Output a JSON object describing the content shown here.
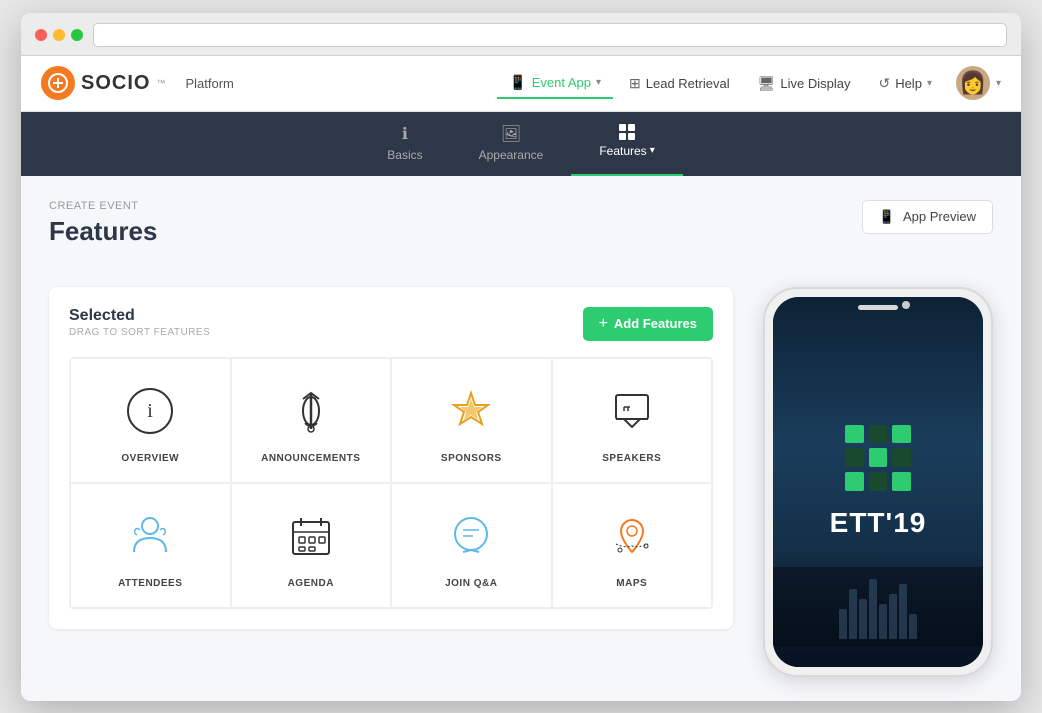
{
  "browser": {
    "url": ""
  },
  "topNav": {
    "logo_text": "SOCIO",
    "logo_tm": "™",
    "platform_label": "Platform",
    "nav_items": [
      {
        "id": "event-app",
        "label": "Event App",
        "icon": "phone",
        "has_chevron": true,
        "active": true
      },
      {
        "id": "lead-retrieval",
        "label": "Lead Retrieval",
        "icon": "scan",
        "has_chevron": false,
        "active": false
      },
      {
        "id": "live-display",
        "label": "Live Display",
        "icon": "monitor",
        "has_chevron": false,
        "active": false
      },
      {
        "id": "help",
        "label": "Help",
        "icon": "refresh",
        "has_chevron": true,
        "active": false
      }
    ]
  },
  "subNav": {
    "items": [
      {
        "id": "basics",
        "label": "Basics",
        "icon": "info",
        "active": false
      },
      {
        "id": "appearance",
        "label": "Appearance",
        "icon": "image",
        "active": false
      },
      {
        "id": "features",
        "label": "Features",
        "icon": "grid",
        "active": true,
        "has_chevron": true
      }
    ]
  },
  "page": {
    "breadcrumb": "CREATE EVENT",
    "title": "Features",
    "app_preview_btn": "App Preview"
  },
  "featuresPanel": {
    "title": "Selected",
    "subtitle": "DRAG TO SORT FEATURES",
    "add_btn": "Add Features",
    "features": [
      {
        "id": "overview",
        "label": "OVERVIEW"
      },
      {
        "id": "announcements",
        "label": "ANNOUNCEMENTS"
      },
      {
        "id": "sponsors",
        "label": "SPONSORS"
      },
      {
        "id": "speakers",
        "label": "SPEAKERS"
      },
      {
        "id": "attendees",
        "label": "ATTENDEES"
      },
      {
        "id": "agenda",
        "label": "AGENDA"
      },
      {
        "id": "join-qa",
        "label": "JOIN Q&A"
      },
      {
        "id": "maps",
        "label": "MAPS"
      }
    ]
  },
  "phoneMockup": {
    "event_name": "ETT'19"
  }
}
